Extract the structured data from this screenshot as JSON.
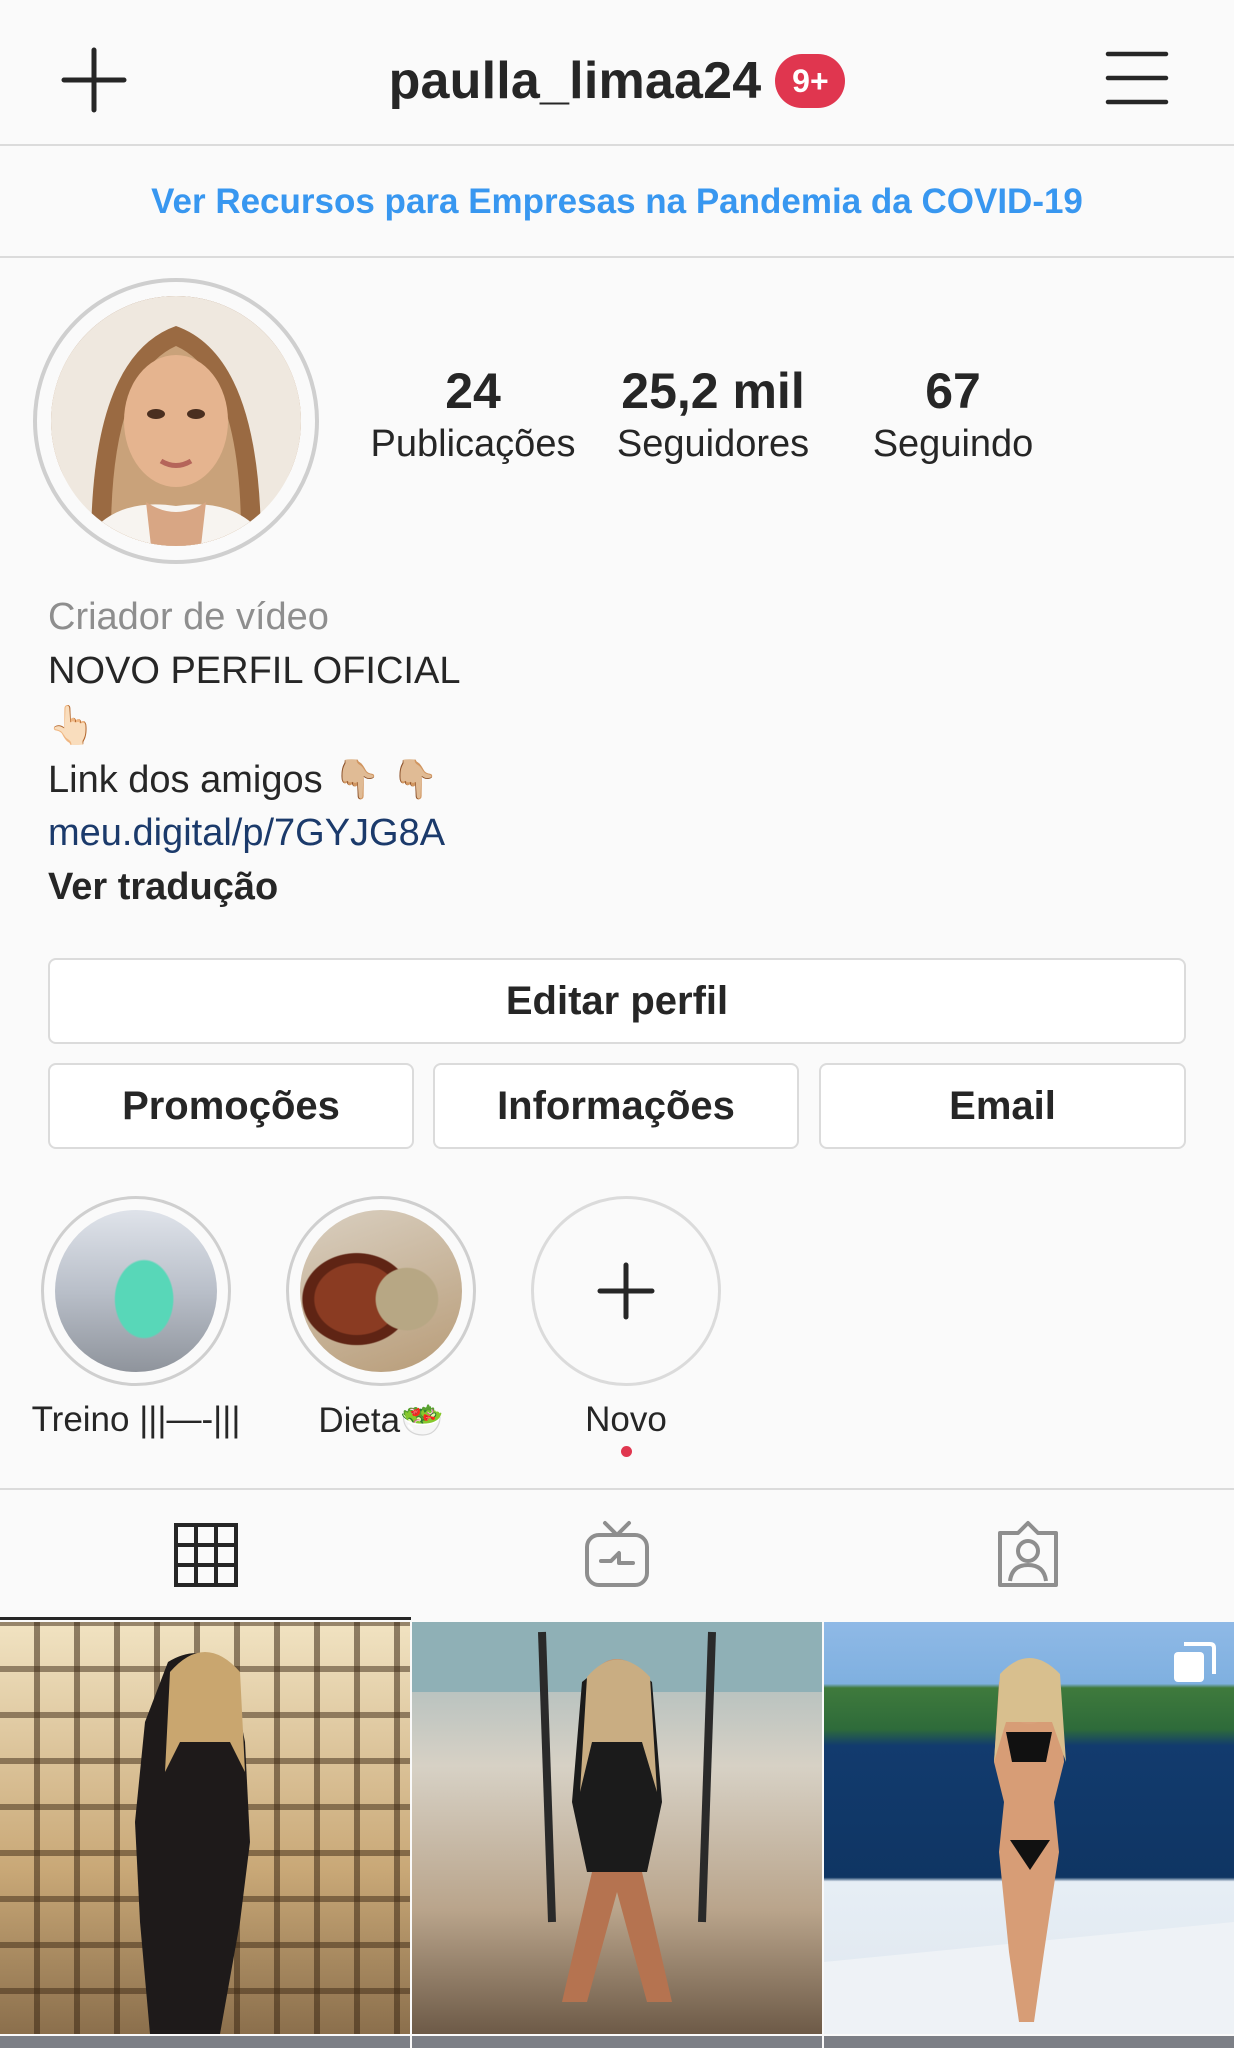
{
  "header": {
    "username": "paulla_limaa24",
    "notification_badge": "9+",
    "new_post_icon": "plus-icon",
    "menu_icon": "hamburger-menu-icon"
  },
  "banner": {
    "text": "Ver Recursos para Empresas na Pandemia da COVID-19"
  },
  "profile": {
    "avatar_icon": "profile-photo",
    "stats": [
      {
        "value": "24",
        "label": "Publicações"
      },
      {
        "value": "25,2 mil",
        "label": "Seguidores"
      },
      {
        "value": "67",
        "label": "Seguindo"
      }
    ],
    "bio": {
      "category": "Criador de vídeo",
      "line1": "NOVO PERFIL OFICIAL",
      "line2_emoji": "👆🏻",
      "line3": "Link dos amigos",
      "line3_emoji": "👇🏼 👇🏼",
      "url": "meu.digital/p/7GYJG8A",
      "translate": "Ver tradução"
    }
  },
  "buttons": {
    "edit": "Editar perfil",
    "promotions": "Promoções",
    "info": "Informações",
    "email": "Email"
  },
  "highlights": [
    {
      "label": "Treino |||—-|||"
    },
    {
      "label": "Dieta🥗"
    },
    {
      "label": "Novo"
    }
  ],
  "tabs": [
    {
      "icon": "grid-icon",
      "active": true
    },
    {
      "icon": "igtv-icon",
      "active": false
    },
    {
      "icon": "tagged-icon",
      "active": false
    }
  ],
  "colors": {
    "link_blue": "#3897f0",
    "badge_red": "#e0364f",
    "url_navy": "#1b3a6b",
    "border": "#dbdbdb"
  }
}
